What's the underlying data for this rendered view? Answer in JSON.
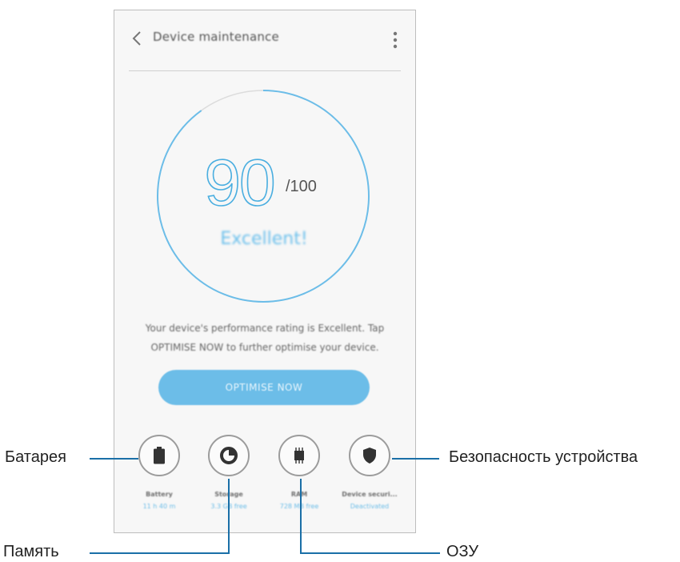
{
  "app": {
    "title": "Device maintenance"
  },
  "score": {
    "value": "90",
    "max": "/100",
    "rating": "Excellent!"
  },
  "description": "Your device's performance rating is Excellent. Tap OPTIMISE NOW to further optimise your device.",
  "optimise_button": "OPTIMISE NOW",
  "tools": [
    {
      "label": "Battery",
      "value": "11 h 40 m",
      "icon": "battery-icon"
    },
    {
      "label": "Storage",
      "value": "3.3 GB free",
      "icon": "storage-icon"
    },
    {
      "label": "RAM",
      "value": "728 MB free",
      "icon": "ram-chip-icon"
    },
    {
      "label": "Device securi...",
      "value": "Deactivated",
      "icon": "shield-icon"
    }
  ],
  "callouts": {
    "battery": "Батарея",
    "storage": "Память",
    "ram": "ОЗУ",
    "security": "Безопасность устройства"
  },
  "colors": {
    "accent": "#4aaee0",
    "button": "#6cbde8",
    "line": "#1a6fa7"
  }
}
